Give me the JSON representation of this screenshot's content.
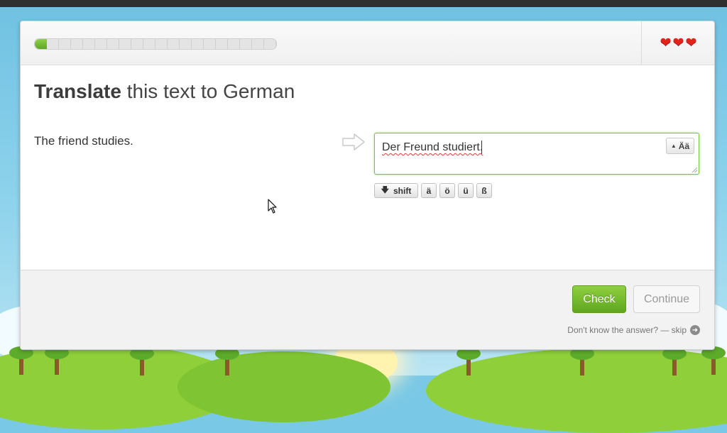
{
  "header": {
    "progress_fraction": 0.05,
    "progress_segments": 20,
    "lives": 3,
    "heart_icon": "heart-icon",
    "heart_color": "#e2231a"
  },
  "exercise": {
    "title_bold": "Translate",
    "title_rest": " this text to German",
    "source_text": "The friend studies.",
    "answer_value": "Der Freund studiert.",
    "case_toggle_label": "Ää"
  },
  "keyboard": {
    "shift_label": "shift",
    "keys": [
      "ä",
      "ö",
      "ü",
      "ß"
    ]
  },
  "footer": {
    "check_label": "Check",
    "continue_label": "Continue",
    "skip_text": "Don't know the answer? — skip"
  },
  "colors": {
    "accent_green": "#7bc142",
    "check_button": "#6fb62a"
  }
}
